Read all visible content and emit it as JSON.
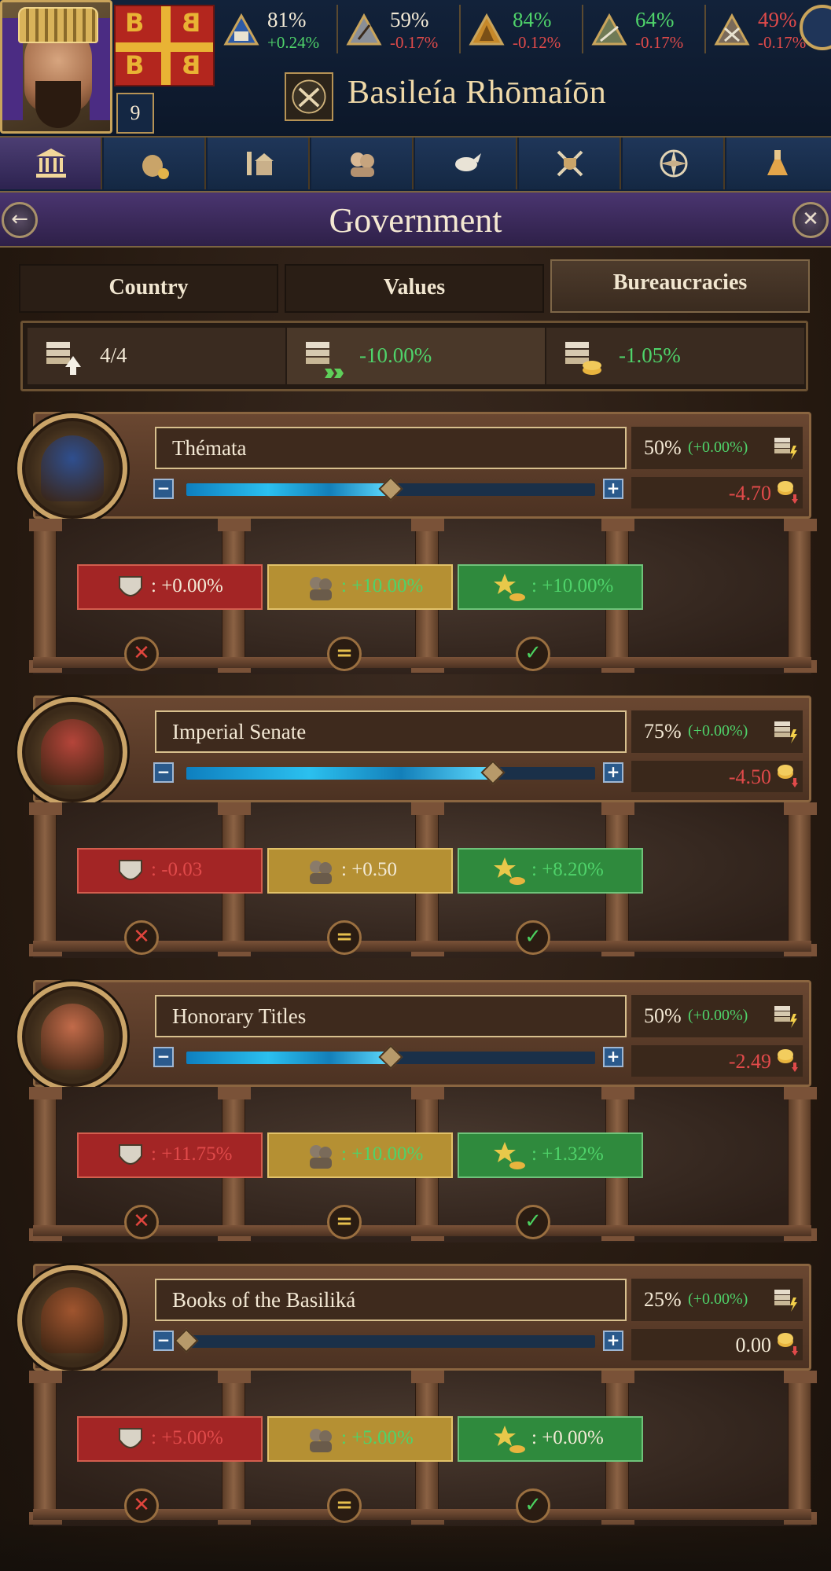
{
  "ruler": {
    "level": "9"
  },
  "stats": [
    {
      "icon": "estate-clergy-icon",
      "percent": "81%",
      "change": "+0.24%",
      "change_color": "green"
    },
    {
      "icon": "estate-nobility-icon",
      "percent": "59%",
      "change": "-0.17%",
      "change_color": "red"
    },
    {
      "icon": "estate-burghers-icon",
      "percent": "84%",
      "change": "-0.12%",
      "change_color": "red"
    },
    {
      "icon": "estate-peasants-icon",
      "percent": "64%",
      "change": "-0.17%",
      "change_color": "red"
    },
    {
      "icon": "estate-tribes-icon",
      "percent": "49%",
      "change": "-0.17%",
      "change_color": "red"
    }
  ],
  "country": {
    "name": "Basileía Rhōmaíōn"
  },
  "nav_tabs": [
    {
      "icon": "government-icon",
      "active": true
    },
    {
      "icon": "economy-icon",
      "active": false
    },
    {
      "icon": "buildings-icon",
      "active": false
    },
    {
      "icon": "characters-icon",
      "active": false
    },
    {
      "icon": "diplomacy-icon",
      "active": false
    },
    {
      "icon": "military-icon",
      "active": false
    },
    {
      "icon": "exploration-icon",
      "active": false
    },
    {
      "icon": "technology-icon",
      "active": false
    }
  ],
  "header": {
    "title": "Government"
  },
  "subtabs": {
    "country": "Country",
    "values": "Values",
    "bureaucracies": "Bureaucracies",
    "active": "bureaucracies"
  },
  "summary": {
    "slots": "4/4",
    "efficiency": "-10.00%",
    "cost": "-1.05%"
  },
  "bureaucracies": [
    {
      "name": "Thémata",
      "percent": "50%",
      "delta": "(+0.00%)",
      "level": 0.5,
      "cost": "-4.70",
      "cost_color": "red",
      "hat_color": "#2f4f8f",
      "effects": {
        "neg": ": +0.00%",
        "neu": ": +10.00%",
        "pos": ": +10.00%"
      },
      "effect_colors": {
        "neg": "white",
        "neu": "green",
        "pos": "green"
      }
    },
    {
      "name": "Imperial Senate",
      "percent": "75%",
      "delta": "(+0.00%)",
      "level": 0.75,
      "cost": "-4.50",
      "cost_color": "red",
      "hat_color": "#b5453a",
      "effects": {
        "neg": ": -0.03",
        "neu": ": +0.50",
        "pos": ": +8.20%"
      },
      "effect_colors": {
        "neg": "red",
        "neu": "white",
        "pos": "green"
      }
    },
    {
      "name": "Honorary Titles",
      "percent": "50%",
      "delta": "(+0.00%)",
      "level": 0.5,
      "cost": "-2.49",
      "cost_color": "red",
      "hat_color": "#c26b4a",
      "effects": {
        "neg": ": +11.75%",
        "neu": ": +10.00%",
        "pos": ": +1.32%"
      },
      "effect_colors": {
        "neg": "red",
        "neu": "green",
        "pos": "green"
      }
    },
    {
      "name": "Books of the Basiliká",
      "percent": "25%",
      "delta": "(+0.00%)",
      "level": 0.0,
      "cost": "0.00",
      "cost_color": "white",
      "hat_color": "#a0552f",
      "effects": {
        "neg": ": +5.00%",
        "neu": ": +5.00%",
        "pos": ": +0.00%"
      },
      "effect_colors": {
        "neg": "red",
        "neu": "green",
        "pos": "white"
      }
    }
  ]
}
